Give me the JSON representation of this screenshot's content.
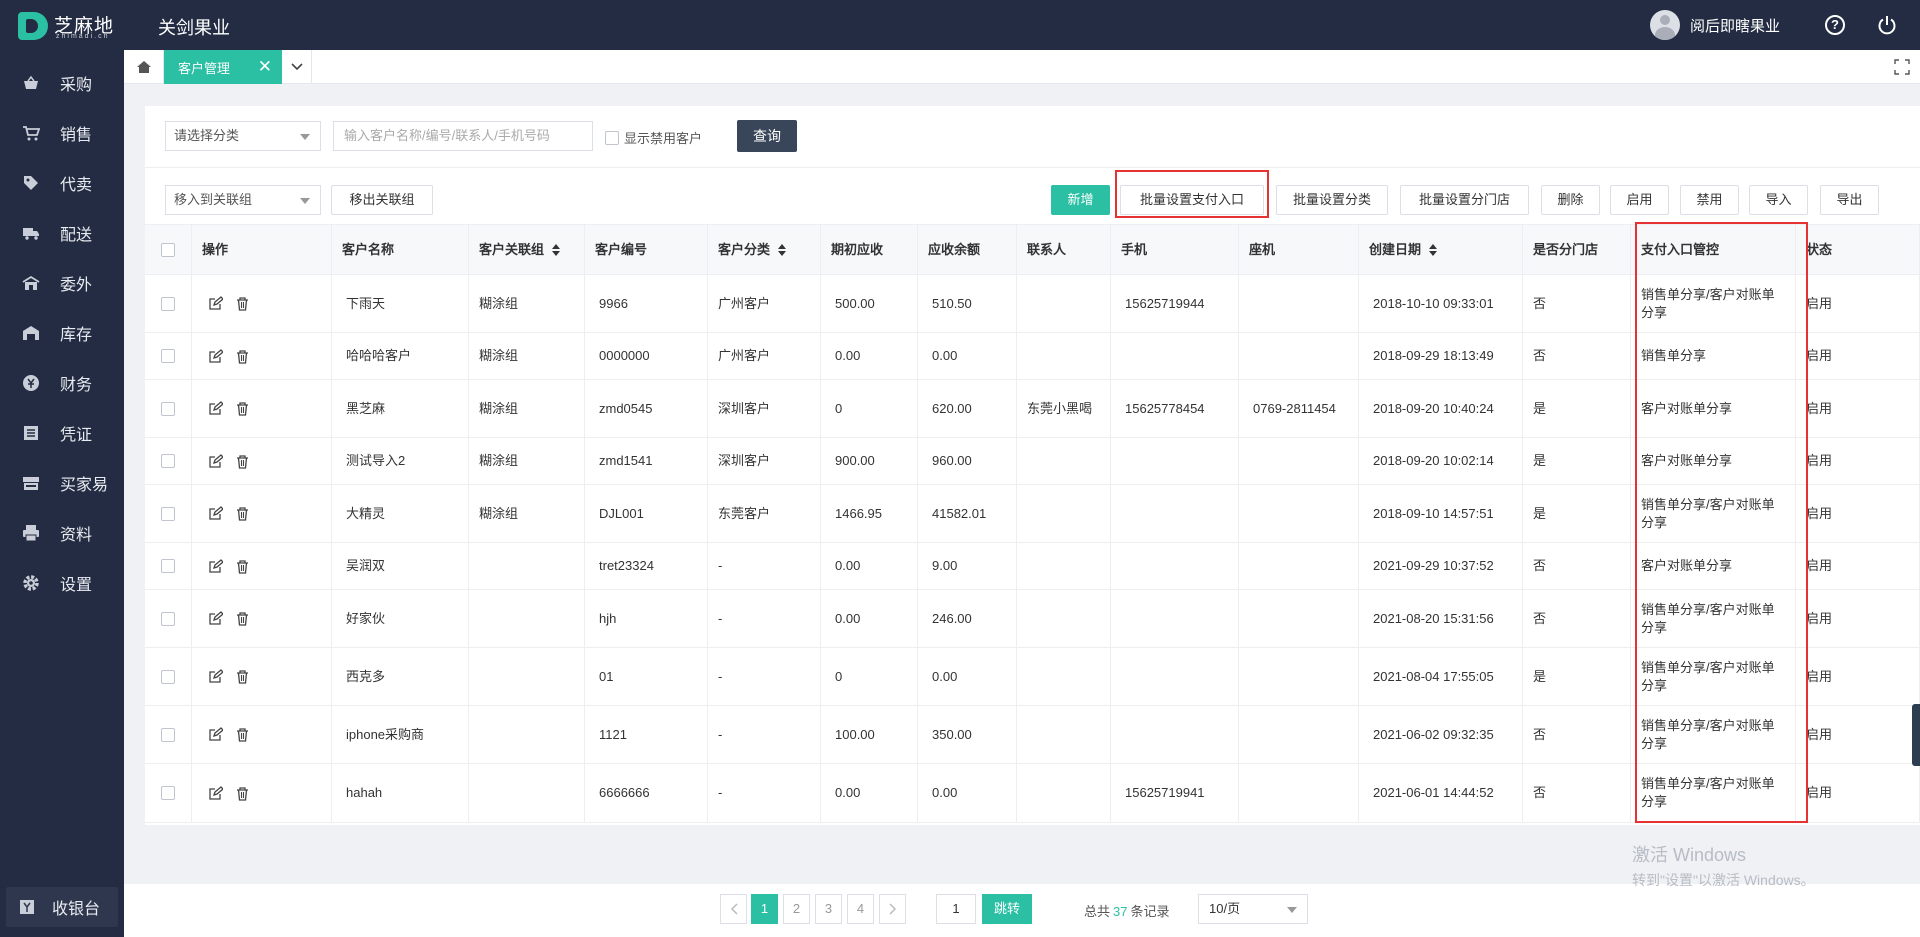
{
  "brand": {
    "logo_cn": "芝麻地",
    "logo_en": "zhimadi.cn",
    "app_title": "关剑果业"
  },
  "header": {
    "user_name": "阅后即瞎果业"
  },
  "sidebar": {
    "items": [
      {
        "label": "采购",
        "icon": "basket-icon"
      },
      {
        "label": "销售",
        "icon": "cart-icon"
      },
      {
        "label": "代卖",
        "icon": "tag-icon"
      },
      {
        "label": "配送",
        "icon": "truck-icon"
      },
      {
        "label": "委外",
        "icon": "building-icon"
      },
      {
        "label": "库存",
        "icon": "warehouse-icon"
      },
      {
        "label": "财务",
        "icon": "yen-icon"
      },
      {
        "label": "凭证",
        "icon": "voucher-icon"
      },
      {
        "label": "买家易",
        "icon": "store-icon"
      },
      {
        "label": "资料",
        "icon": "printer-icon"
      },
      {
        "label": "设置",
        "icon": "gear-icon"
      }
    ],
    "cashier": "收银台"
  },
  "tabs": {
    "active": "客户管理"
  },
  "filters": {
    "category_select": "请选择分类",
    "search_placeholder": "输入客户名称/编号/联系人/手机号码",
    "show_disabled": "显示禁用客户",
    "query": "查询"
  },
  "actions": {
    "move_to_group": "移入到关联组",
    "move_out_group": "移出关联组",
    "add": "新增",
    "batch_payment": "批量设置支付入口",
    "batch_category": "批量设置分类",
    "batch_branch": "批量设置分门店",
    "delete": "删除",
    "enable": "启用",
    "disable": "禁用",
    "import": "导入",
    "export": "导出"
  },
  "table": {
    "headers": {
      "op": "操作",
      "name": "客户名称",
      "group": "客户关联组",
      "code": "客户编号",
      "category": "客户分类",
      "initial": "期初应收",
      "balance": "应收余额",
      "contact": "联系人",
      "mobile": "手机",
      "phone": "座机",
      "created": "创建日期",
      "branch": "是否分门店",
      "payment": "支付入口管控",
      "status": "状态"
    },
    "rows": [
      {
        "name": "下雨天",
        "group": "糊涂组",
        "code": "9966",
        "category": "广州客户",
        "initial": "500.00",
        "balance": "510.50",
        "contact": "",
        "mobile": "15625719944",
        "phone": "",
        "created": "2018-10-10 09:33:01",
        "branch": "否",
        "payment": "销售单分享/客户对账单分享",
        "status": "启用"
      },
      {
        "name": "哈哈哈客户",
        "group": "糊涂组",
        "code": "0000000",
        "category": "广州客户",
        "initial": "0.00",
        "balance": "0.00",
        "contact": "",
        "mobile": "",
        "phone": "",
        "created": "2018-09-29 18:13:49",
        "branch": "否",
        "payment": "销售单分享",
        "status": "启用"
      },
      {
        "name": "黑芝麻",
        "group": "糊涂组",
        "code": "zmd0545",
        "category": "深圳客户",
        "initial": "0",
        "balance": "620.00",
        "contact": "东莞小黑喝",
        "mobile": "15625778454",
        "phone": "0769-2811454",
        "created": "2018-09-20 10:40:24",
        "branch": "是",
        "payment": "客户对账单分享",
        "status": "启用"
      },
      {
        "name": "测试导入2",
        "group": "糊涂组",
        "code": "zmd1541",
        "category": "深圳客户",
        "initial": "900.00",
        "balance": "960.00",
        "contact": "",
        "mobile": "",
        "phone": "",
        "created": "2018-09-20 10:02:14",
        "branch": "是",
        "payment": "客户对账单分享",
        "status": "启用"
      },
      {
        "name": "大精灵",
        "group": "糊涂组",
        "code": "DJL001",
        "category": "东莞客户",
        "initial": "1466.95",
        "balance": "41582.01",
        "contact": "",
        "mobile": "",
        "phone": "",
        "created": "2018-09-10 14:57:51",
        "branch": "是",
        "payment": "销售单分享/客户对账单分享",
        "status": "启用"
      },
      {
        "name": "吴润双",
        "group": "",
        "code": "tret23324",
        "category": "-",
        "initial": "0.00",
        "balance": "9.00",
        "contact": "",
        "mobile": "",
        "phone": "",
        "created": "2021-09-29 10:37:52",
        "branch": "否",
        "payment": "客户对账单分享",
        "status": "启用"
      },
      {
        "name": "好家伙",
        "group": "",
        "code": "hjh",
        "category": "-",
        "initial": "0.00",
        "balance": "246.00",
        "contact": "",
        "mobile": "",
        "phone": "",
        "created": "2021-08-20 15:31:56",
        "branch": "否",
        "payment": "销售单分享/客户对账单分享",
        "status": "启用"
      },
      {
        "name": "西克多",
        "group": "",
        "code": "01",
        "category": "-",
        "initial": "0",
        "balance": "0.00",
        "contact": "",
        "mobile": "",
        "phone": "",
        "created": "2021-08-04 17:55:05",
        "branch": "是",
        "payment": "销售单分享/客户对账单分享",
        "status": "启用"
      },
      {
        "name": "iphone采购商",
        "group": "",
        "code": "1121",
        "category": "-",
        "initial": "100.00",
        "balance": "350.00",
        "contact": "",
        "mobile": "",
        "phone": "",
        "created": "2021-06-02 09:32:35",
        "branch": "否",
        "payment": "销售单分享/客户对账单分享",
        "status": "启用"
      },
      {
        "name": "hahah",
        "group": "",
        "code": "6666666",
        "category": "-",
        "initial": "0.00",
        "balance": "0.00",
        "contact": "",
        "mobile": "15625719941",
        "phone": "",
        "created": "2021-06-01 14:44:52",
        "branch": "否",
        "payment": "销售单分享/客户对账单分享",
        "status": "启用"
      }
    ]
  },
  "pagination": {
    "pages": [
      "1",
      "2",
      "3",
      "4"
    ],
    "current": "1",
    "jump_value": "1",
    "jump_label": "跳转",
    "total_prefix": "总共",
    "total": "37",
    "total_suffix": "条记录",
    "page_size": "10/页"
  },
  "watermark": {
    "line1": "激活 Windows",
    "line2": "转到\"设置\"以激活 Windows。"
  },
  "colors": {
    "accent": "#2bbfa4",
    "sidebar": "#232c42",
    "highlight": "#e63232"
  }
}
